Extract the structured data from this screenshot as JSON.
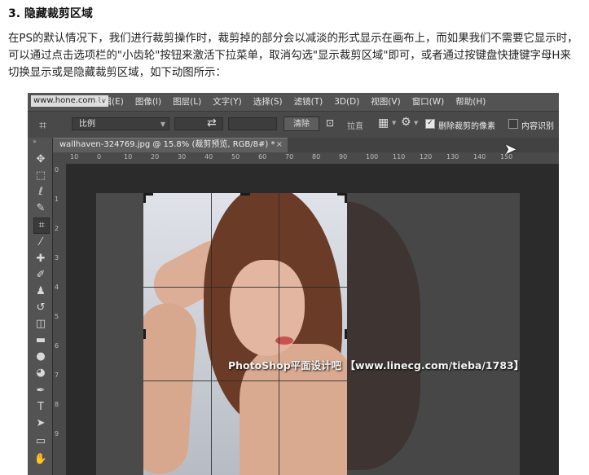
{
  "article": {
    "heading": "3. 隐藏裁剪区域",
    "paragraph": "在PS的默认情况下，我们进行裁剪操作时，裁剪掉的部分会以减淡的形式显示在画布上，而如果我们不需要它显示时，可以通过点击选项栏的\"小齿轮\"按钮来激活下拉菜单，取消勾选\"显示裁剪区域\"即可，或者通过按键盘快捷键字母H来切换显示或是隐藏裁剪区域，如下动图所示："
  },
  "photoshop": {
    "site_watermark": "www.hone.com.tv",
    "menu": [
      "编辑(E)",
      "图像(I)",
      "图层(L)",
      "文字(Y)",
      "选择(S)",
      "滤镜(T)",
      "3D(D)",
      "视图(V)",
      "窗口(W)",
      "帮助(H)"
    ],
    "options": {
      "crop_icon": "crop-icon",
      "ratio_select": "比例",
      "clear_button": "清除",
      "straighten_label": "拉直",
      "delete_cropped_label": "删除裁剪的像素",
      "delete_cropped_checked": true,
      "content_aware_label": "内容识别",
      "content_aware_checked": false
    },
    "tab": {
      "title": "wallhaven-324769.jpg @ 15.8% (裁剪预览, RGB/8#) *",
      "close": "×"
    },
    "ruler_h": [
      "10",
      "0",
      "10",
      "20",
      "30",
      "40",
      "50",
      "60",
      "70",
      "80",
      "90",
      "100",
      "110",
      "120",
      "130",
      "140",
      "150"
    ],
    "ruler_v": [
      "0",
      "1",
      "2",
      "3",
      "4",
      "5",
      "6",
      "7",
      "8",
      "9"
    ],
    "tools": [
      "move-icon",
      "marquee-icon",
      "lasso-icon",
      "quick-select-icon",
      "crop-icon",
      "eyedropper-icon",
      "healing-icon",
      "brush-icon",
      "stamp-icon",
      "history-brush-icon",
      "eraser-icon",
      "gradient-icon",
      "blur-icon",
      "dodge-icon",
      "pen-icon",
      "type-icon",
      "path-select-icon",
      "shape-icon",
      "hand-icon"
    ],
    "forum_watermark": "PhotoShop平面设计吧 【www.linecg.com/tieba/1783】"
  }
}
